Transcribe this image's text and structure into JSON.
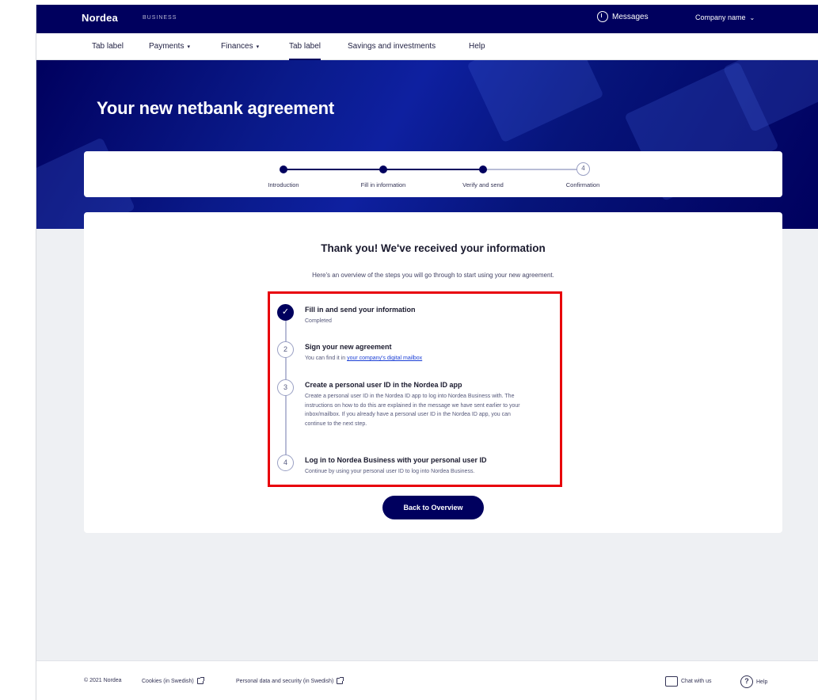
{
  "topbar": {
    "logo": "Nordea",
    "subtitle": "BUSINESS",
    "messages_label": "Messages",
    "company_label": "Company name"
  },
  "nav": {
    "items": [
      {
        "label": "Tab label",
        "has_menu": false,
        "active": false
      },
      {
        "label": "Payments",
        "has_menu": true,
        "active": false
      },
      {
        "label": "Finances",
        "has_menu": true,
        "active": false
      },
      {
        "label": "Tab label",
        "has_menu": false,
        "active": true
      },
      {
        "label": "Savings and investments",
        "has_menu": false,
        "active": false
      },
      {
        "label": "Help",
        "has_menu": false,
        "active": false
      }
    ]
  },
  "hero": {
    "title": "Your new netbank agreement"
  },
  "stepper": {
    "steps": [
      {
        "label": "Introduction",
        "state": "done"
      },
      {
        "label": "Fill in information",
        "state": "done"
      },
      {
        "label": "Verify and send",
        "state": "done"
      },
      {
        "label": "Confirmation",
        "state": "current",
        "number": "4"
      }
    ]
  },
  "confirmation": {
    "title": "Thank you! We've received your information",
    "subtitle": "Here's an overview of the steps you will go through to start using your new agreement.",
    "steps": [
      {
        "badge": "✓",
        "done": true,
        "title": "Fill in and send your information",
        "desc": "Completed",
        "link": ""
      },
      {
        "badge": "2",
        "done": false,
        "title": "Sign your new agreement",
        "desc": "You can find it in",
        "link": "your company's digital mailbox"
      },
      {
        "badge": "3",
        "done": false,
        "title": "Create a personal user ID in the Nordea ID app",
        "desc": "Create a personal user ID in the Nordea ID app to log into Nordea Business with. The instructions on how to do this are explained in the message we have sent earlier to your inbox/mailbox. If you already have a personal user ID in the Nordea ID app, you can continue to the next step.",
        "link": ""
      },
      {
        "badge": "4",
        "done": false,
        "title": "Log in to Nordea Business with your personal user ID",
        "desc": "Continue by using your personal user ID to log into Nordea Business.",
        "link": ""
      }
    ],
    "back_button": "Back to Overview"
  },
  "footer": {
    "copyright": "© 2021 Nordea",
    "link1": "Cookies (in Swedish)",
    "link2": "Personal data and security (in Swedish)",
    "chat_label": "Chat with us",
    "help_label": "Help"
  },
  "colors": {
    "brand_navy": "#00005e",
    "highlight_red": "#e8000a",
    "link_blue": "#1b3fd6"
  }
}
